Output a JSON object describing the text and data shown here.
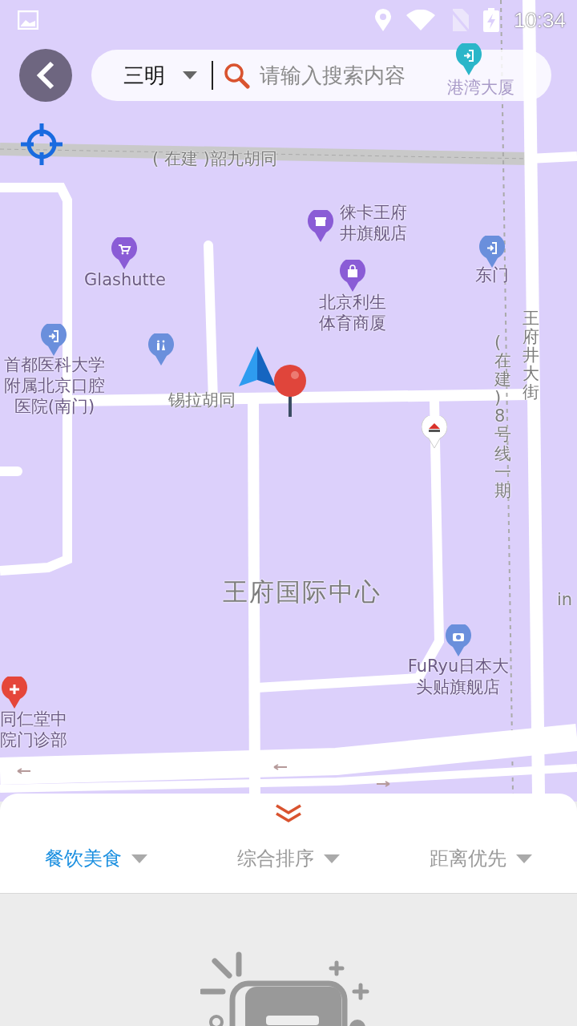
{
  "status_bar": {
    "time": "10:34"
  },
  "search_bar": {
    "city": "三明",
    "placeholder": "请输入搜索内容"
  },
  "map": {
    "pois": [
      {
        "kind": "building",
        "lines": [
          "港湾大厦"
        ]
      },
      {
        "kind": "shop",
        "lines": [
          "徕卡王府",
          "井旗舰店"
        ]
      },
      {
        "kind": "cart",
        "lines": [
          "Glashutte"
        ]
      },
      {
        "kind": "exit",
        "lines": [
          "东门"
        ]
      },
      {
        "kind": "bag",
        "lines": [
          "北京利生",
          "体育商厦"
        ]
      },
      {
        "kind": "exit",
        "lines": [
          "首都医科大学",
          "附属北京口腔",
          "医院(南门)"
        ]
      },
      {
        "kind": "toilet"
      },
      {
        "kind": "pizza"
      },
      {
        "kind": "camera",
        "lines": [
          "FuRyu日本大",
          "头贴旗舰店"
        ]
      },
      {
        "kind": "hospital",
        "lines": [
          "同仁堂中",
          "院门诊部"
        ]
      }
    ],
    "labels": [
      {
        "kind": "road",
        "text": "( 在建 )韶九胡同"
      },
      {
        "kind": "road",
        "text": "锡拉胡同"
      },
      {
        "kind": "vertical",
        "text": "王府井大街"
      },
      {
        "kind": "vertical",
        "text": "(在建)8号线一期"
      },
      {
        "kind": "area",
        "text": "王府国际中心"
      },
      {
        "kind": "road",
        "text": "in"
      }
    ]
  },
  "filters": [
    {
      "label": "餐饮美食",
      "selected": true
    },
    {
      "label": "综合排序",
      "selected": false
    },
    {
      "label": "距离优先",
      "selected": false
    }
  ]
}
